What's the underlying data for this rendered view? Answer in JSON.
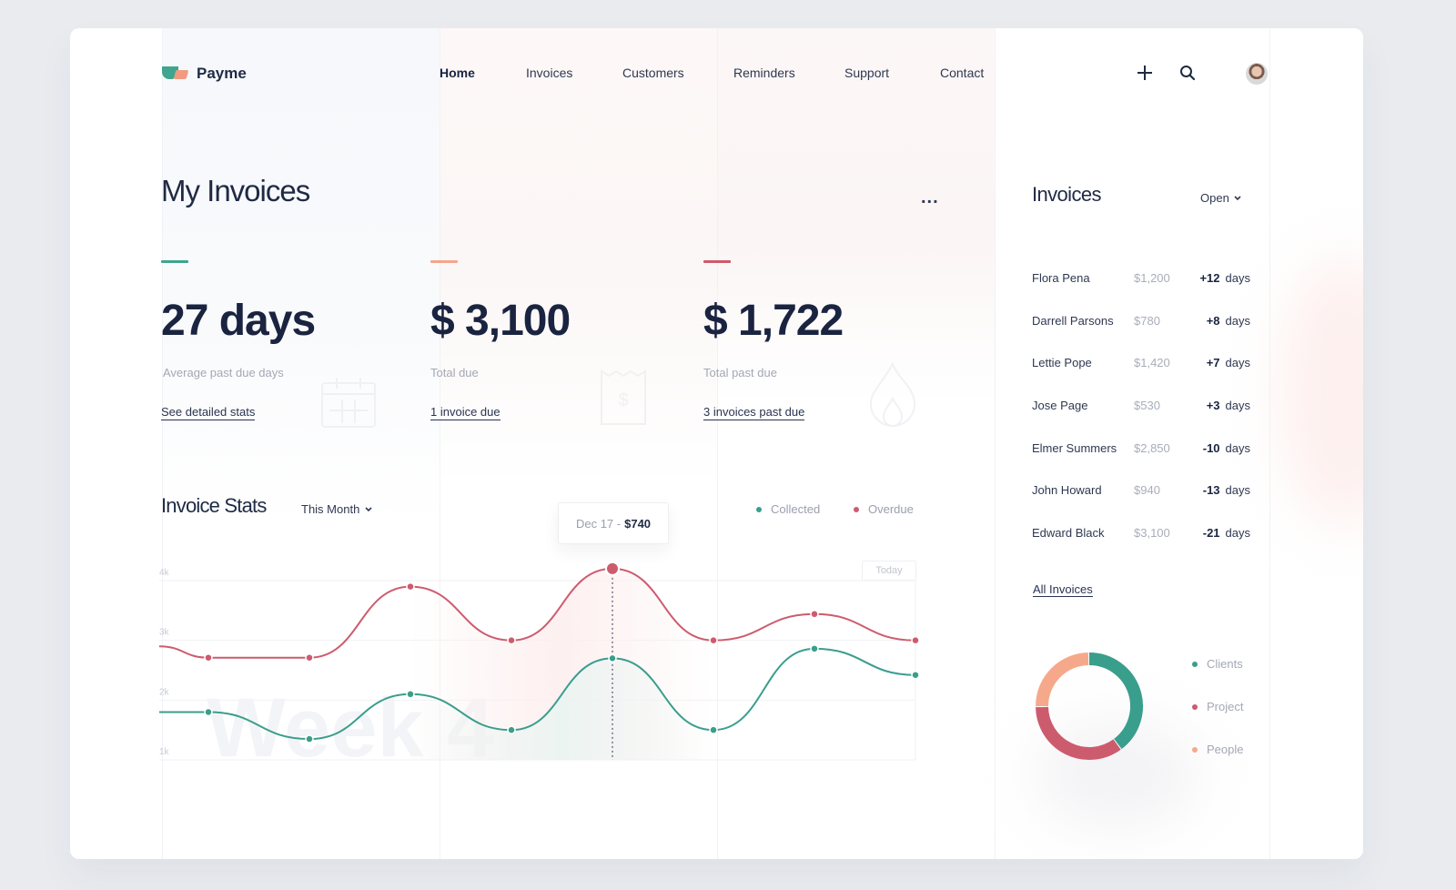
{
  "app": {
    "name": "Payme"
  },
  "nav": {
    "items": [
      {
        "label": "Home",
        "active": true
      },
      {
        "label": "Invoices",
        "active": false
      },
      {
        "label": "Customers",
        "active": false
      },
      {
        "label": "Reminders",
        "active": false
      },
      {
        "label": "Support",
        "active": false
      },
      {
        "label": "Contact",
        "active": false
      }
    ],
    "icons": [
      "plus-icon",
      "search-icon",
      "avatar"
    ]
  },
  "page": {
    "title": "My Invoices",
    "more_label": "..."
  },
  "stats": [
    {
      "value": "27 days",
      "label": "Average past due days",
      "link": "See detailed stats",
      "accent": "#3fa58e",
      "icon": "calendar-icon"
    },
    {
      "value": "$ 3,100",
      "label": "Total due",
      "link": "1 invoice due",
      "accent": "#f4a58b",
      "icon": "receipt-icon"
    },
    {
      "value": "$ 1,722",
      "label": "Total past due",
      "link": "3 invoices past due",
      "accent": "#cf5a6b",
      "icon": "fire-icon"
    }
  ],
  "invoice_stats": {
    "title": "Invoice Stats",
    "period": "This Month",
    "legend": [
      {
        "name": "Collected",
        "color": "#3a9e8c"
      },
      {
        "name": "Overdue",
        "color": "#cd5b6e"
      }
    ],
    "tooltip": {
      "date": "Dec 17 -",
      "value": "$740"
    },
    "today_label": "Today",
    "watermark": "Week 4"
  },
  "chart_data": {
    "type": "line",
    "title": "Invoice Stats",
    "xlabel": "",
    "ylabel": "",
    "y_ticks": [
      "4k",
      "3k",
      "2k",
      "1k"
    ],
    "ylim": [
      1000,
      4000
    ],
    "grid": true,
    "legend_position": "top-right",
    "x": [
      0,
      1,
      2,
      3,
      4,
      5,
      6,
      7,
      8
    ],
    "series": [
      {
        "name": "Overdue",
        "color": "#cd5b6e",
        "values": [
          2900,
          2710,
          2710,
          3900,
          3000,
          4200,
          3000,
          3440,
          3000
        ]
      },
      {
        "name": "Collected",
        "color": "#3a9e8c",
        "values": [
          1800,
          1800,
          1350,
          2100,
          1500,
          2700,
          1500,
          2860,
          2420
        ]
      }
    ],
    "highlight_index": 5,
    "markers_from_index": 1
  },
  "sidebar": {
    "title": "Invoices",
    "filter": "Open",
    "invoices": [
      {
        "name": "Flora Pena",
        "amount": "$1,200",
        "delta": "+12",
        "unit": "days"
      },
      {
        "name": "Darrell Parsons",
        "amount": "$780",
        "delta": "+8",
        "unit": "days"
      },
      {
        "name": "Lettie Pope",
        "amount": "$1,420",
        "delta": "+7",
        "unit": "days"
      },
      {
        "name": "Jose Page",
        "amount": "$530",
        "delta": "+3",
        "unit": "days"
      },
      {
        "name": "Elmer Summers",
        "amount": "$2,850",
        "delta": "-10",
        "unit": "days"
      },
      {
        "name": "John Howard",
        "amount": "$940",
        "delta": "-13",
        "unit": "days"
      },
      {
        "name": "Edward Black",
        "amount": "$3,100",
        "delta": "-21",
        "unit": "days"
      }
    ],
    "all_link": "All Invoices",
    "donut": {
      "type": "pie",
      "segments": [
        {
          "name": "Clients",
          "value": 40,
          "color": "#3a9e8c"
        },
        {
          "name": "Project",
          "value": 35,
          "color": "#cd5b6e"
        },
        {
          "name": "People",
          "value": 25,
          "color": "#f6a98a"
        }
      ]
    }
  }
}
